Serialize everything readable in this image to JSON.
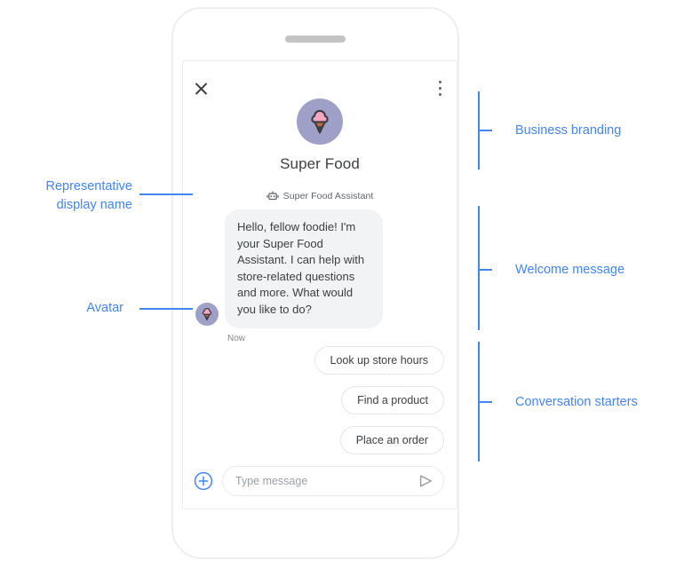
{
  "phone": {
    "speaker_name": "phone-speaker"
  },
  "chat": {
    "header": {
      "close_icon": "close-icon",
      "overflow_icon": "overflow-menu-icon"
    },
    "branding": {
      "logo_icon": "ice-cream-cone-logo",
      "business_name": "Super Food"
    },
    "representative": {
      "bot_icon": "bot-icon",
      "display_name": "Super Food Assistant"
    },
    "welcome": {
      "avatar_icon": "ice-cream-cone-avatar",
      "text": "Hello, fellow foodie! I'm your Super Food Assistant. I can help with store-related questions and more. What would you like to do?",
      "timestamp": "Now"
    },
    "starters": [
      {
        "label": "Look up store hours"
      },
      {
        "label": "Find a product"
      },
      {
        "label": "Place an order"
      }
    ],
    "composer": {
      "plus_icon": "add-attachment-icon",
      "placeholder": "Type message",
      "input_value": "",
      "send_icon": "send-icon"
    }
  },
  "annotations": {
    "left": [
      {
        "label": "Representative\ndisplay name"
      },
      {
        "label": "Avatar"
      }
    ],
    "right": [
      {
        "label": "Business branding"
      },
      {
        "label": "Welcome message"
      },
      {
        "label": "Conversation starters"
      }
    ]
  },
  "colors": {
    "accent": "#4285f4",
    "avatar_bg": "#9fa0c8",
    "scoop": "#f7a8c0",
    "cone": "#b5713a",
    "outline": "#3c3c44",
    "bubble_bg": "#f1f3f4",
    "text_primary": "#3c4043",
    "text_secondary": "#5f6368",
    "frame": "#eceef1"
  }
}
